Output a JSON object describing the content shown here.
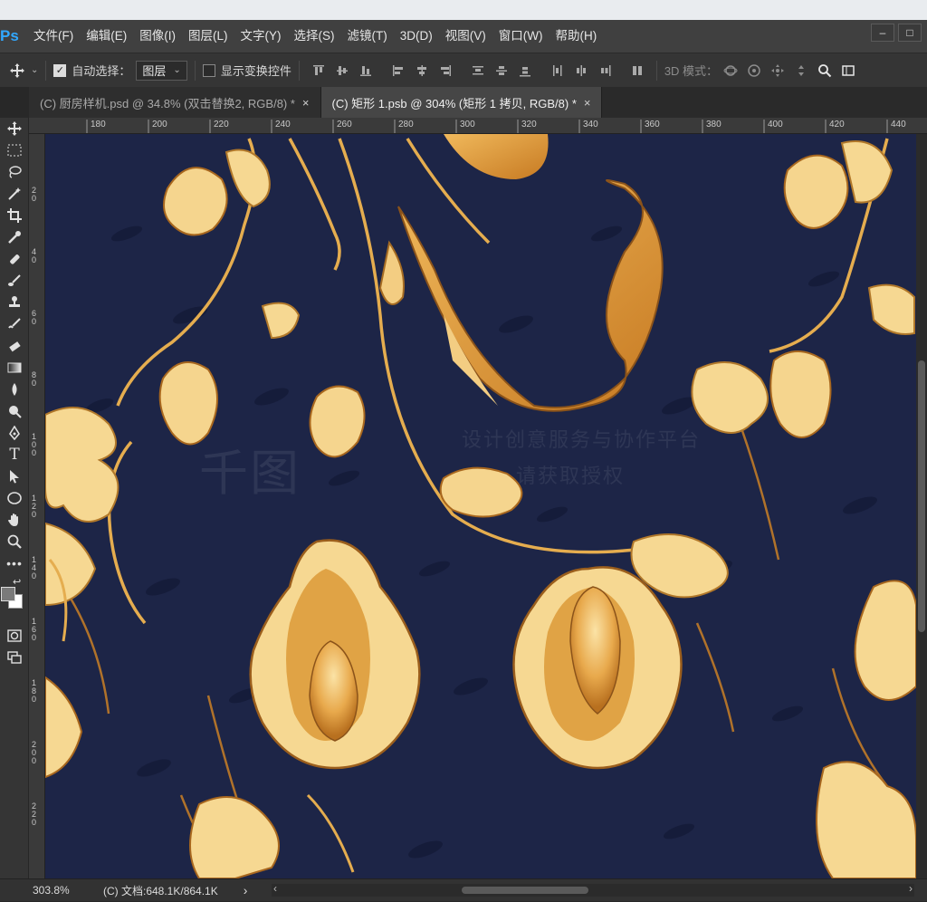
{
  "app": {
    "logo": "Ps",
    "menu": [
      "文件(F)",
      "编辑(E)",
      "图像(I)",
      "图层(L)",
      "文字(Y)",
      "选择(S)",
      "滤镜(T)",
      "3D(D)",
      "视图(V)",
      "窗口(W)",
      "帮助(H)"
    ],
    "window_controls": [
      "–",
      "□"
    ]
  },
  "options": {
    "auto_select_label": "自动选择：",
    "auto_select_checked": true,
    "auto_select_value": "图层",
    "transform_controls_label": "显示变换控件",
    "mode_3d_label": "3D 模式："
  },
  "tabs": [
    {
      "label": "(C) 厨房样机.psd @ 34.8% (双击替换2, RGB/8) *",
      "close": "×",
      "active": false
    },
    {
      "label": "(C) 矩形 1.psb @ 304% (矩形 1 拷贝, RGB/8) *",
      "close": "×",
      "active": true
    }
  ],
  "ruler_top": [
    "180",
    "200",
    "220",
    "240",
    "260",
    "280",
    "300",
    "320",
    "340",
    "360",
    "380",
    "400",
    "420",
    "440"
  ],
  "ruler_left": [
    "2 0",
    "4 0",
    "6 0",
    "8 0",
    "1 0 0",
    "1 2 0",
    "1 4 0",
    "1 6 0",
    "1 8 0",
    "2 0 0",
    "2 2 0"
  ],
  "watermark": [
    "千图",
    "设计创意服务与协作平台",
    "请获取授权"
  ],
  "status": {
    "zoom": "303.8%",
    "doc_info": "(C) 文档:648.1K/864.1K",
    "arrow": "›",
    "left_arrow": "‹",
    "right_arrow": "›"
  },
  "colors": {
    "canvas_bg": "#1d2547",
    "gold_light": "#f4d28c",
    "gold_mid": "#e2a54a",
    "gold_dark": "#c47e26",
    "ui_panel": "#353535"
  }
}
